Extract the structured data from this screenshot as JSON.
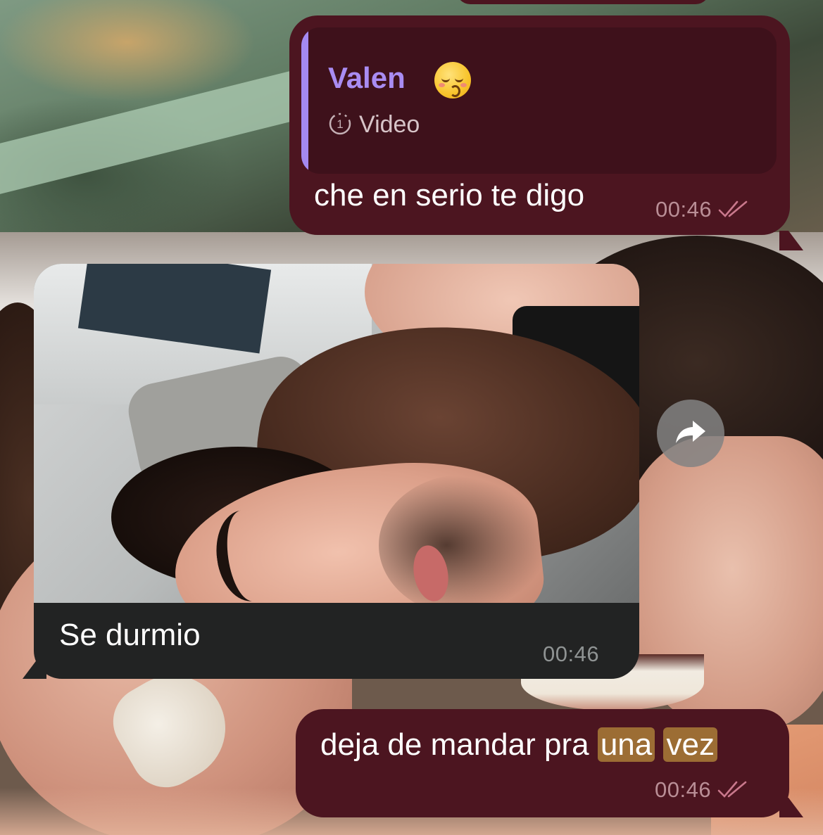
{
  "messages": [
    {
      "direction": "outgoing",
      "reply_to": {
        "name": "Valen",
        "name_emoji": "kissing-face-with-closed-eyes",
        "media_icon": "view-once-1-icon",
        "media_label": "Video"
      },
      "text": "che en serio te digo",
      "time": "00:46",
      "status": "read"
    },
    {
      "direction": "incoming",
      "has_photo": true,
      "text": "Se durmio",
      "time": "00:46"
    },
    {
      "direction": "outgoing",
      "text_parts": [
        "deja de mandar pra ",
        "una",
        " ",
        "vez"
      ],
      "highlighted_words": [
        "una",
        "vez"
      ],
      "time": "00:46",
      "status": "read"
    }
  ],
  "colors": {
    "outgoing_bubble": "#4c1520",
    "incoming_bubble": "#222323",
    "reply_accent": "#a489f0",
    "search_highlight": "#9c6d34",
    "read_checks": "#c9788c"
  },
  "icons": {
    "forward": "forward-share-icon",
    "read_receipt": "double-check-icon"
  }
}
